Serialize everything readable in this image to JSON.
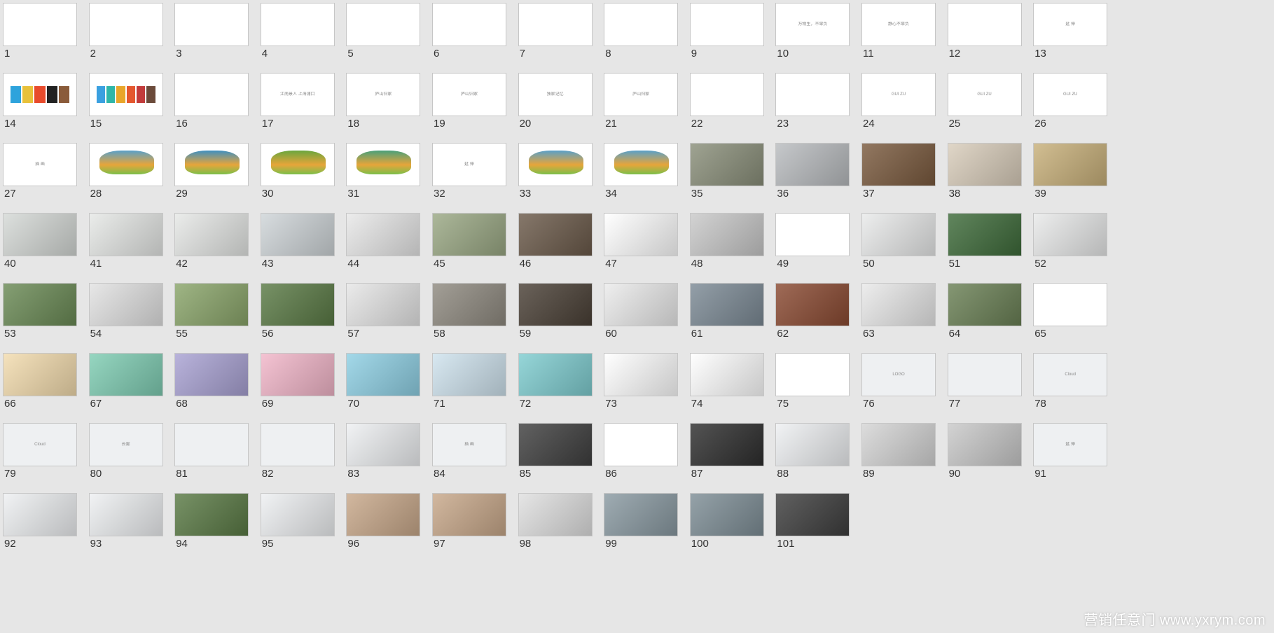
{
  "slides": [
    {
      "num": "1",
      "bg": "#ffffff"
    },
    {
      "num": "2",
      "bg": "#ffffff"
    },
    {
      "num": "3",
      "bg": "#ffffff"
    },
    {
      "num": "4",
      "bg": "#ffffff"
    },
    {
      "num": "5",
      "bg": "#ffffff"
    },
    {
      "num": "6",
      "bg": "#ffffff"
    },
    {
      "num": "7",
      "bg": "#ffffff"
    },
    {
      "num": "8",
      "bg": "#ffffff"
    },
    {
      "num": "9",
      "bg": "#ffffff"
    },
    {
      "num": "10",
      "bg": "#ffffff",
      "caption": "万物生，不辜负"
    },
    {
      "num": "11",
      "bg": "#ffffff",
      "caption": "静心不辜负"
    },
    {
      "num": "12",
      "bg": "#ffffff"
    },
    {
      "num": "13",
      "bg": "#ffffff",
      "caption": "延 伸"
    },
    {
      "num": "14",
      "bg": "#ffffff",
      "palette": [
        "#2ea3dc",
        "#e8c13a",
        "#e84b2c",
        "#222222",
        "#8a5b3a"
      ]
    },
    {
      "num": "15",
      "bg": "#ffffff",
      "palette": [
        "#3aa0e0",
        "#2fb6a8",
        "#e9a62a",
        "#e4572e",
        "#c23b3b",
        "#6b4a3a"
      ]
    },
    {
      "num": "16",
      "bg": "#ffffff"
    },
    {
      "num": "17",
      "bg": "#ffffff",
      "caption": "江南景人  上海浦口"
    },
    {
      "num": "18",
      "bg": "#ffffff",
      "caption": "庐山归家"
    },
    {
      "num": "19",
      "bg": "#ffffff",
      "caption": "庐山归家"
    },
    {
      "num": "20",
      "bg": "#ffffff",
      "caption": "独家记忆"
    },
    {
      "num": "21",
      "bg": "#ffffff",
      "caption": "庐山归家"
    },
    {
      "num": "22",
      "bg": "#ffffff"
    },
    {
      "num": "23",
      "bg": "#ffffff"
    },
    {
      "num": "24",
      "bg": "#ffffff",
      "caption": "GUI ZU"
    },
    {
      "num": "25",
      "bg": "#ffffff",
      "caption": "GUI ZU"
    },
    {
      "num": "26",
      "bg": "#ffffff",
      "caption": "GUI ZU"
    },
    {
      "num": "27",
      "bg": "#ffffff",
      "caption": "插 画"
    },
    {
      "num": "28",
      "bg": "#ffffff",
      "art": "#5aa0c8"
    },
    {
      "num": "29",
      "bg": "#ffffff",
      "art": "#3f8fc0"
    },
    {
      "num": "30",
      "bg": "#ffffff",
      "art": "#6aa63e"
    },
    {
      "num": "31",
      "bg": "#ffffff",
      "art": "#4aa07a"
    },
    {
      "num": "32",
      "bg": "#ffffff",
      "caption": "延 伸"
    },
    {
      "num": "33",
      "bg": "#ffffff",
      "art": "#5aa0c8"
    },
    {
      "num": "34",
      "bg": "#ffffff",
      "art": "#5aa0c8"
    },
    {
      "num": "35",
      "bg": "#8a8f7a",
      "photo": true
    },
    {
      "num": "36",
      "bg": "#b9bcbf",
      "photo": true
    },
    {
      "num": "37",
      "bg": "#7a5a3e",
      "photo": true
    },
    {
      "num": "38",
      "bg": "#d9cdbb",
      "photo": true
    },
    {
      "num": "39",
      "bg": "#c8b07a",
      "photo": true
    },
    {
      "num": "40",
      "bg": "#d5d9d6",
      "photo": true
    },
    {
      "num": "41",
      "bg": "#e6e8e6",
      "photo": true
    },
    {
      "num": "42",
      "bg": "#e6e8e6",
      "photo": true
    },
    {
      "num": "43",
      "bg": "#cfd5d8",
      "photo": true
    },
    {
      "num": "44",
      "bg": "#e8e8e8",
      "photo": true
    },
    {
      "num": "45",
      "bg": "#9aa884",
      "photo": true
    },
    {
      "num": "46",
      "bg": "#6b5a4a",
      "photo": true
    },
    {
      "num": "47",
      "bg": "#ffffff",
      "photo": true
    },
    {
      "num": "48",
      "bg": "#c9c9c9",
      "photo": true
    },
    {
      "num": "49",
      "bg": "#ffffff"
    },
    {
      "num": "50",
      "bg": "#e9eaea",
      "photo": true
    },
    {
      "num": "51",
      "bg": "#3e6b3a",
      "photo": true
    },
    {
      "num": "52",
      "bg": "#e9eaea",
      "photo": true
    },
    {
      "num": "53",
      "bg": "#6a8a55",
      "photo": true
    },
    {
      "num": "54",
      "bg": "#e2e2e2",
      "photo": true
    },
    {
      "num": "55",
      "bg": "#8aa56a",
      "photo": true
    },
    {
      "num": "56",
      "bg": "#5a7a45",
      "photo": true
    },
    {
      "num": "57",
      "bg": "#e6e6e6",
      "photo": true
    },
    {
      "num": "58",
      "bg": "#8f8a80",
      "photo": true
    },
    {
      "num": "59",
      "bg": "#4a4036",
      "photo": true
    },
    {
      "num": "60",
      "bg": "#ebebeb",
      "photo": true
    },
    {
      "num": "61",
      "bg": "#7c8a95",
      "photo": true
    },
    {
      "num": "62",
      "bg": "#8a4a32",
      "photo": true
    },
    {
      "num": "63",
      "bg": "#e9e9e9",
      "photo": true
    },
    {
      "num": "64",
      "bg": "#6a8055",
      "photo": true
    },
    {
      "num": "65",
      "bg": "#ffffff"
    },
    {
      "num": "66",
      "bg": "#f3dcae",
      "photo": true
    },
    {
      "num": "67",
      "bg": "#7fcdb3",
      "photo": true
    },
    {
      "num": "68",
      "bg": "#a9a2d3",
      "photo": true
    },
    {
      "num": "69",
      "bg": "#f2b6c9",
      "photo": true
    },
    {
      "num": "70",
      "bg": "#8fd0e4",
      "photo": true
    },
    {
      "num": "71",
      "bg": "#cfe3ee",
      "photo": true
    },
    {
      "num": "72",
      "bg": "#7fcdd0",
      "photo": true
    },
    {
      "num": "73",
      "bg": "#ffffff",
      "photo": true
    },
    {
      "num": "74",
      "bg": "#ffffff",
      "photo": true
    },
    {
      "num": "75",
      "bg": "#ffffff"
    },
    {
      "num": "76",
      "bg": "#eef0f2",
      "caption": "LOGO"
    },
    {
      "num": "77",
      "bg": "#eef0f2"
    },
    {
      "num": "78",
      "bg": "#eef0f2",
      "caption": "Cloud"
    },
    {
      "num": "79",
      "bg": "#eef0f2",
      "caption": "Cloud"
    },
    {
      "num": "80",
      "bg": "#eef0f2",
      "caption": "云雾"
    },
    {
      "num": "81",
      "bg": "#eef0f2"
    },
    {
      "num": "82",
      "bg": "#eef0f2"
    },
    {
      "num": "83",
      "bg": "#eef0f2",
      "photo": true
    },
    {
      "num": "84",
      "bg": "#eef0f2",
      "caption": "插 画"
    },
    {
      "num": "85",
      "bg": "#3f3f3f",
      "photo": true
    },
    {
      "num": "86",
      "bg": "#ffffff"
    },
    {
      "num": "87",
      "bg": "#2e2e2e",
      "photo": true
    },
    {
      "num": "88",
      "bg": "#eef0f2",
      "photo": true
    },
    {
      "num": "89",
      "bg": "#d5d5d5",
      "photo": true
    },
    {
      "num": "90",
      "bg": "#c9c9c9",
      "photo": true
    },
    {
      "num": "91",
      "bg": "#eef0f2",
      "caption": "延 伸"
    },
    {
      "num": "92",
      "bg": "#eef0f2",
      "photo": true
    },
    {
      "num": "93",
      "bg": "#eef0f2",
      "photo": true
    },
    {
      "num": "94",
      "bg": "#5a7a45",
      "photo": true
    },
    {
      "num": "95",
      "bg": "#eef0f2",
      "photo": true
    },
    {
      "num": "96",
      "bg": "#c8a88a",
      "photo": true
    },
    {
      "num": "97",
      "bg": "#c8a88a",
      "photo": true
    },
    {
      "num": "98",
      "bg": "#e0e0e0",
      "photo": true
    },
    {
      "num": "99",
      "bg": "#8a9aa2",
      "photo": true
    },
    {
      "num": "100",
      "bg": "#7e8e96",
      "photo": true
    },
    {
      "num": "101",
      "bg": "#3e3e3e",
      "photo": true
    }
  ],
  "watermark": "营销任意门 www.yxrym.com"
}
